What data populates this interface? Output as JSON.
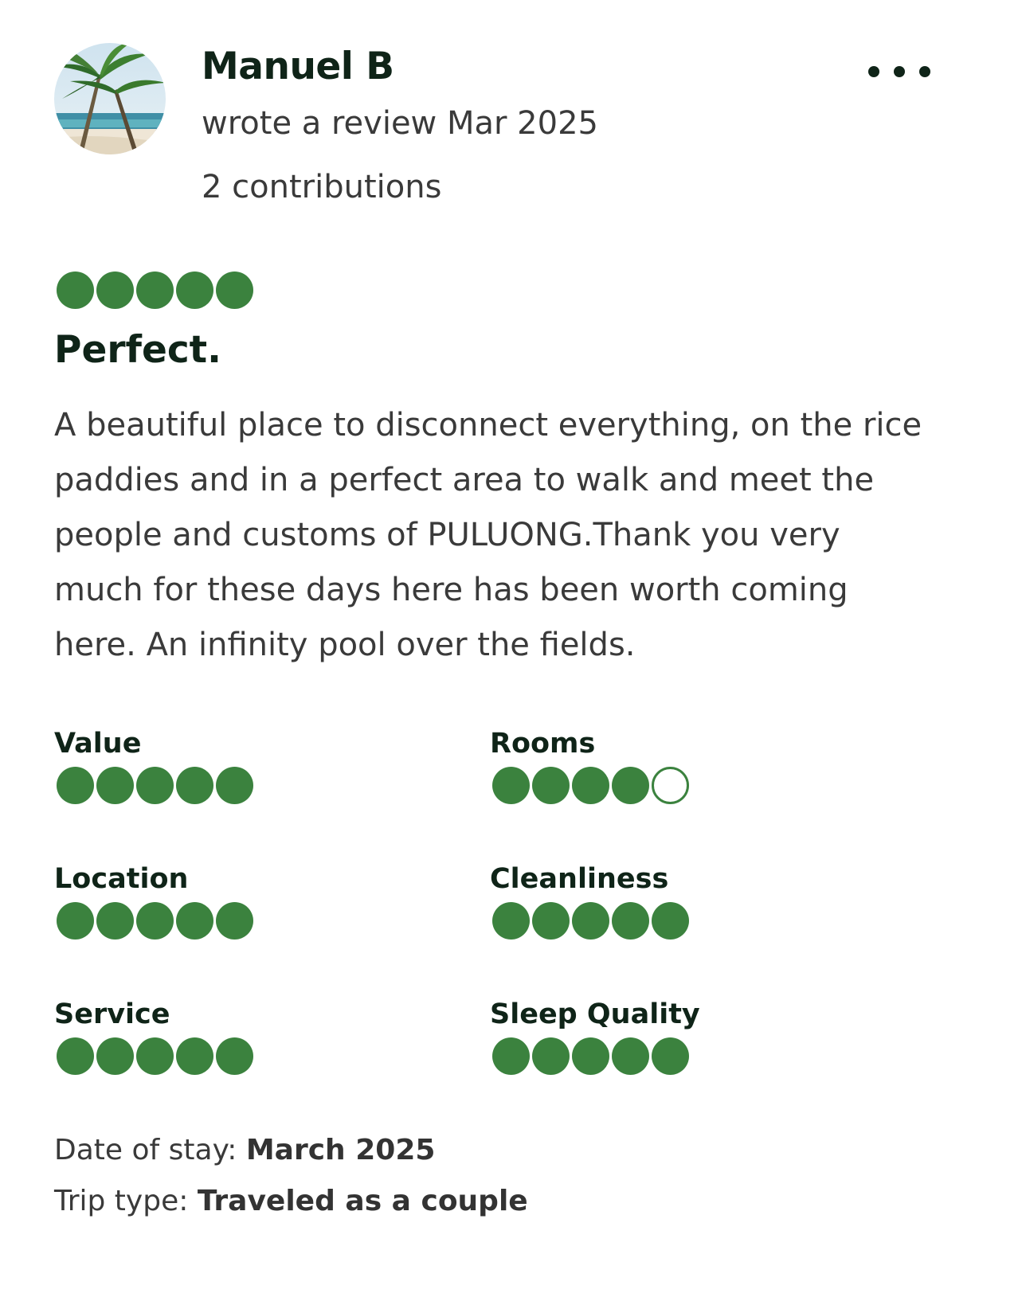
{
  "author": {
    "name": "Manuel B",
    "meta": "wrote a review Mar 2025",
    "contributions": "2 contributions",
    "avatar_icon": "beach-palm-avatar"
  },
  "more_icon": "more-dots-icon",
  "review": {
    "overall_rating": 5,
    "rating_max": 5,
    "title": "Perfect.",
    "body": "A beautiful place to disconnect everything, on the rice paddies and in a perfect area to walk and meet the people and customs of PULUONG.Thank you very much for these days here has been worth coming here. An infinity pool over the fields."
  },
  "subratings": [
    {
      "label": "Value",
      "rating": 5
    },
    {
      "label": "Rooms",
      "rating": 4
    },
    {
      "label": "Location",
      "rating": 5
    },
    {
      "label": "Cleanliness",
      "rating": 5
    },
    {
      "label": "Service",
      "rating": 5
    },
    {
      "label": "Sleep Quality",
      "rating": 5
    }
  ],
  "stay": {
    "date_label": "Date of stay:",
    "date_value": "March 2025",
    "trip_label": "Trip type:",
    "trip_value": "Traveled as a couple"
  },
  "colors": {
    "bubble_fill": "#3b823e",
    "text_dark": "#0f2418",
    "text_body": "#3a3a3a"
  }
}
